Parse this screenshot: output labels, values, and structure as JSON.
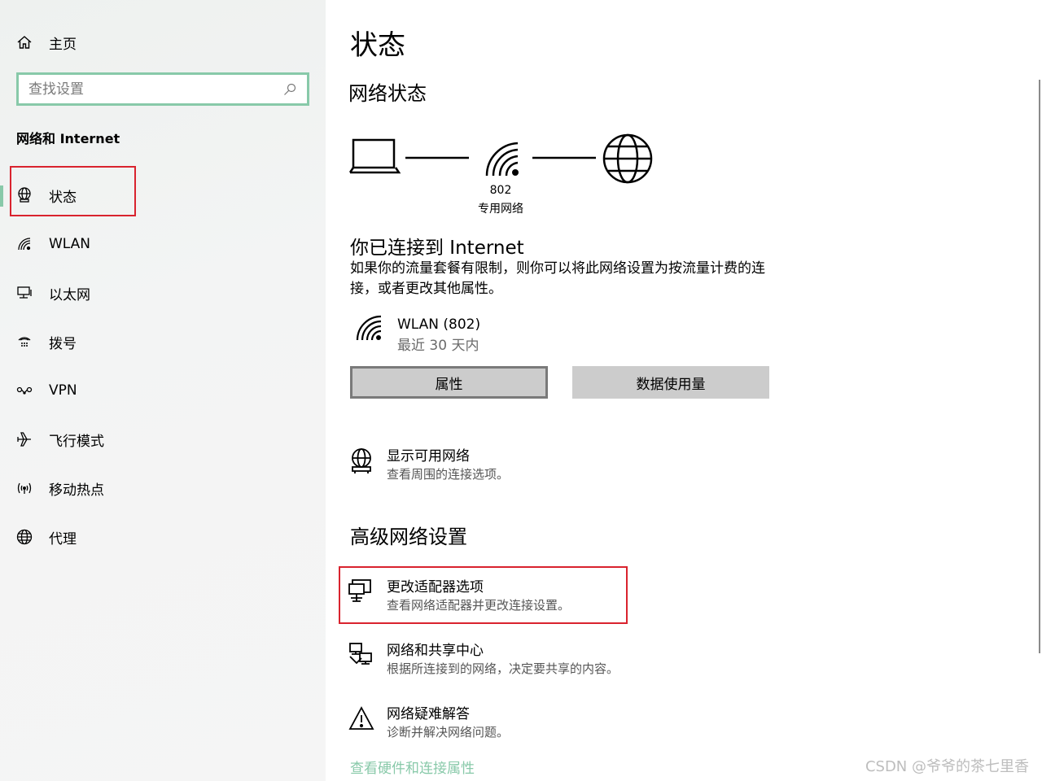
{
  "sidebar": {
    "home_label": "主页",
    "search_placeholder": "查找设置",
    "section_title": "网络和 Internet",
    "items": [
      {
        "label": "状态",
        "icon": "globe-status-icon"
      },
      {
        "label": "WLAN",
        "icon": "wifi-icon"
      },
      {
        "label": "以太网",
        "icon": "ethernet-icon"
      },
      {
        "label": "拨号",
        "icon": "dialup-icon"
      },
      {
        "label": "VPN",
        "icon": "vpn-icon"
      },
      {
        "label": "飞行模式",
        "icon": "airplane-icon"
      },
      {
        "label": "移动热点",
        "icon": "hotspot-icon"
      },
      {
        "label": "代理",
        "icon": "globe-icon"
      }
    ]
  },
  "main": {
    "title": "状态",
    "network_status_title": "网络状态",
    "diagram": {
      "ssid": "802",
      "profile": "专用网络"
    },
    "connected_title": "你已连接到 Internet",
    "connected_desc": "如果你的流量套餐有限制，则你可以将此网络设置为按流量计费的连接，或者更改其他属性。",
    "connection": {
      "name": "WLAN (802)",
      "sub": "最近 30 天内"
    },
    "buttons": {
      "properties": "属性",
      "data_usage": "数据使用量"
    },
    "show_networks": {
      "title": "显示可用网络",
      "sub": "查看周围的连接选项。"
    },
    "advanced_title": "高级网络设置",
    "adapter": {
      "title": "更改适配器选项",
      "sub": "查看网络适配器并更改连接设置。"
    },
    "sharing": {
      "title": "网络和共享中心",
      "sub": "根据所连接到的网络，决定要共享的内容。"
    },
    "troubleshoot": {
      "title": "网络疑难解答",
      "sub": "诊断并解决网络问题。"
    },
    "hardware_link": "查看硬件和连接属性"
  },
  "watermark": "CSDN @爷爷的茶七里香",
  "colors": {
    "accent": "#88c9a9",
    "highlight": "#d9232e",
    "button": "#cccccc"
  }
}
